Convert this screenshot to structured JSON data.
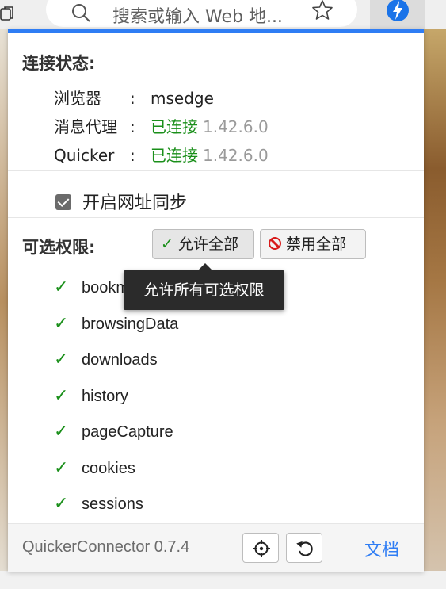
{
  "browser": {
    "address_placeholder": "搜索或输入 Web 地...",
    "extension_accent": "#1a73e8"
  },
  "popup": {
    "accent": "#2f7df4",
    "connection": {
      "title": "连接状态:",
      "rows": [
        {
          "key": "浏览器",
          "sep": ":",
          "value": "msedge",
          "status": "",
          "version": ""
        },
        {
          "key": "消息代理",
          "sep": ":",
          "value": "",
          "status": "已连接",
          "version": "1.42.6.0"
        },
        {
          "key": "Quicker",
          "sep": ":",
          "value": "",
          "status": "已连接",
          "version": "1.42.6.0"
        }
      ]
    },
    "url_sync": {
      "label": "开启网址同步",
      "checked": true
    },
    "permissions": {
      "title": "可选权限:",
      "allow_all": "允许全部",
      "deny_all": "禁用全部",
      "tooltip": "允许所有可选权限",
      "items": [
        "bookmarks",
        "browsingData",
        "downloads",
        "history",
        "pageCapture",
        "cookies",
        "sessions"
      ]
    },
    "footer": {
      "version": "QuickerConnector 0.7.4",
      "docs": "文档"
    }
  },
  "icons": {
    "tab": "tabs-icon",
    "search": "search-icon",
    "star": "star-icon",
    "extension": "lightning-icon",
    "locate": "crosshair-icon",
    "reset": "undo-icon"
  }
}
